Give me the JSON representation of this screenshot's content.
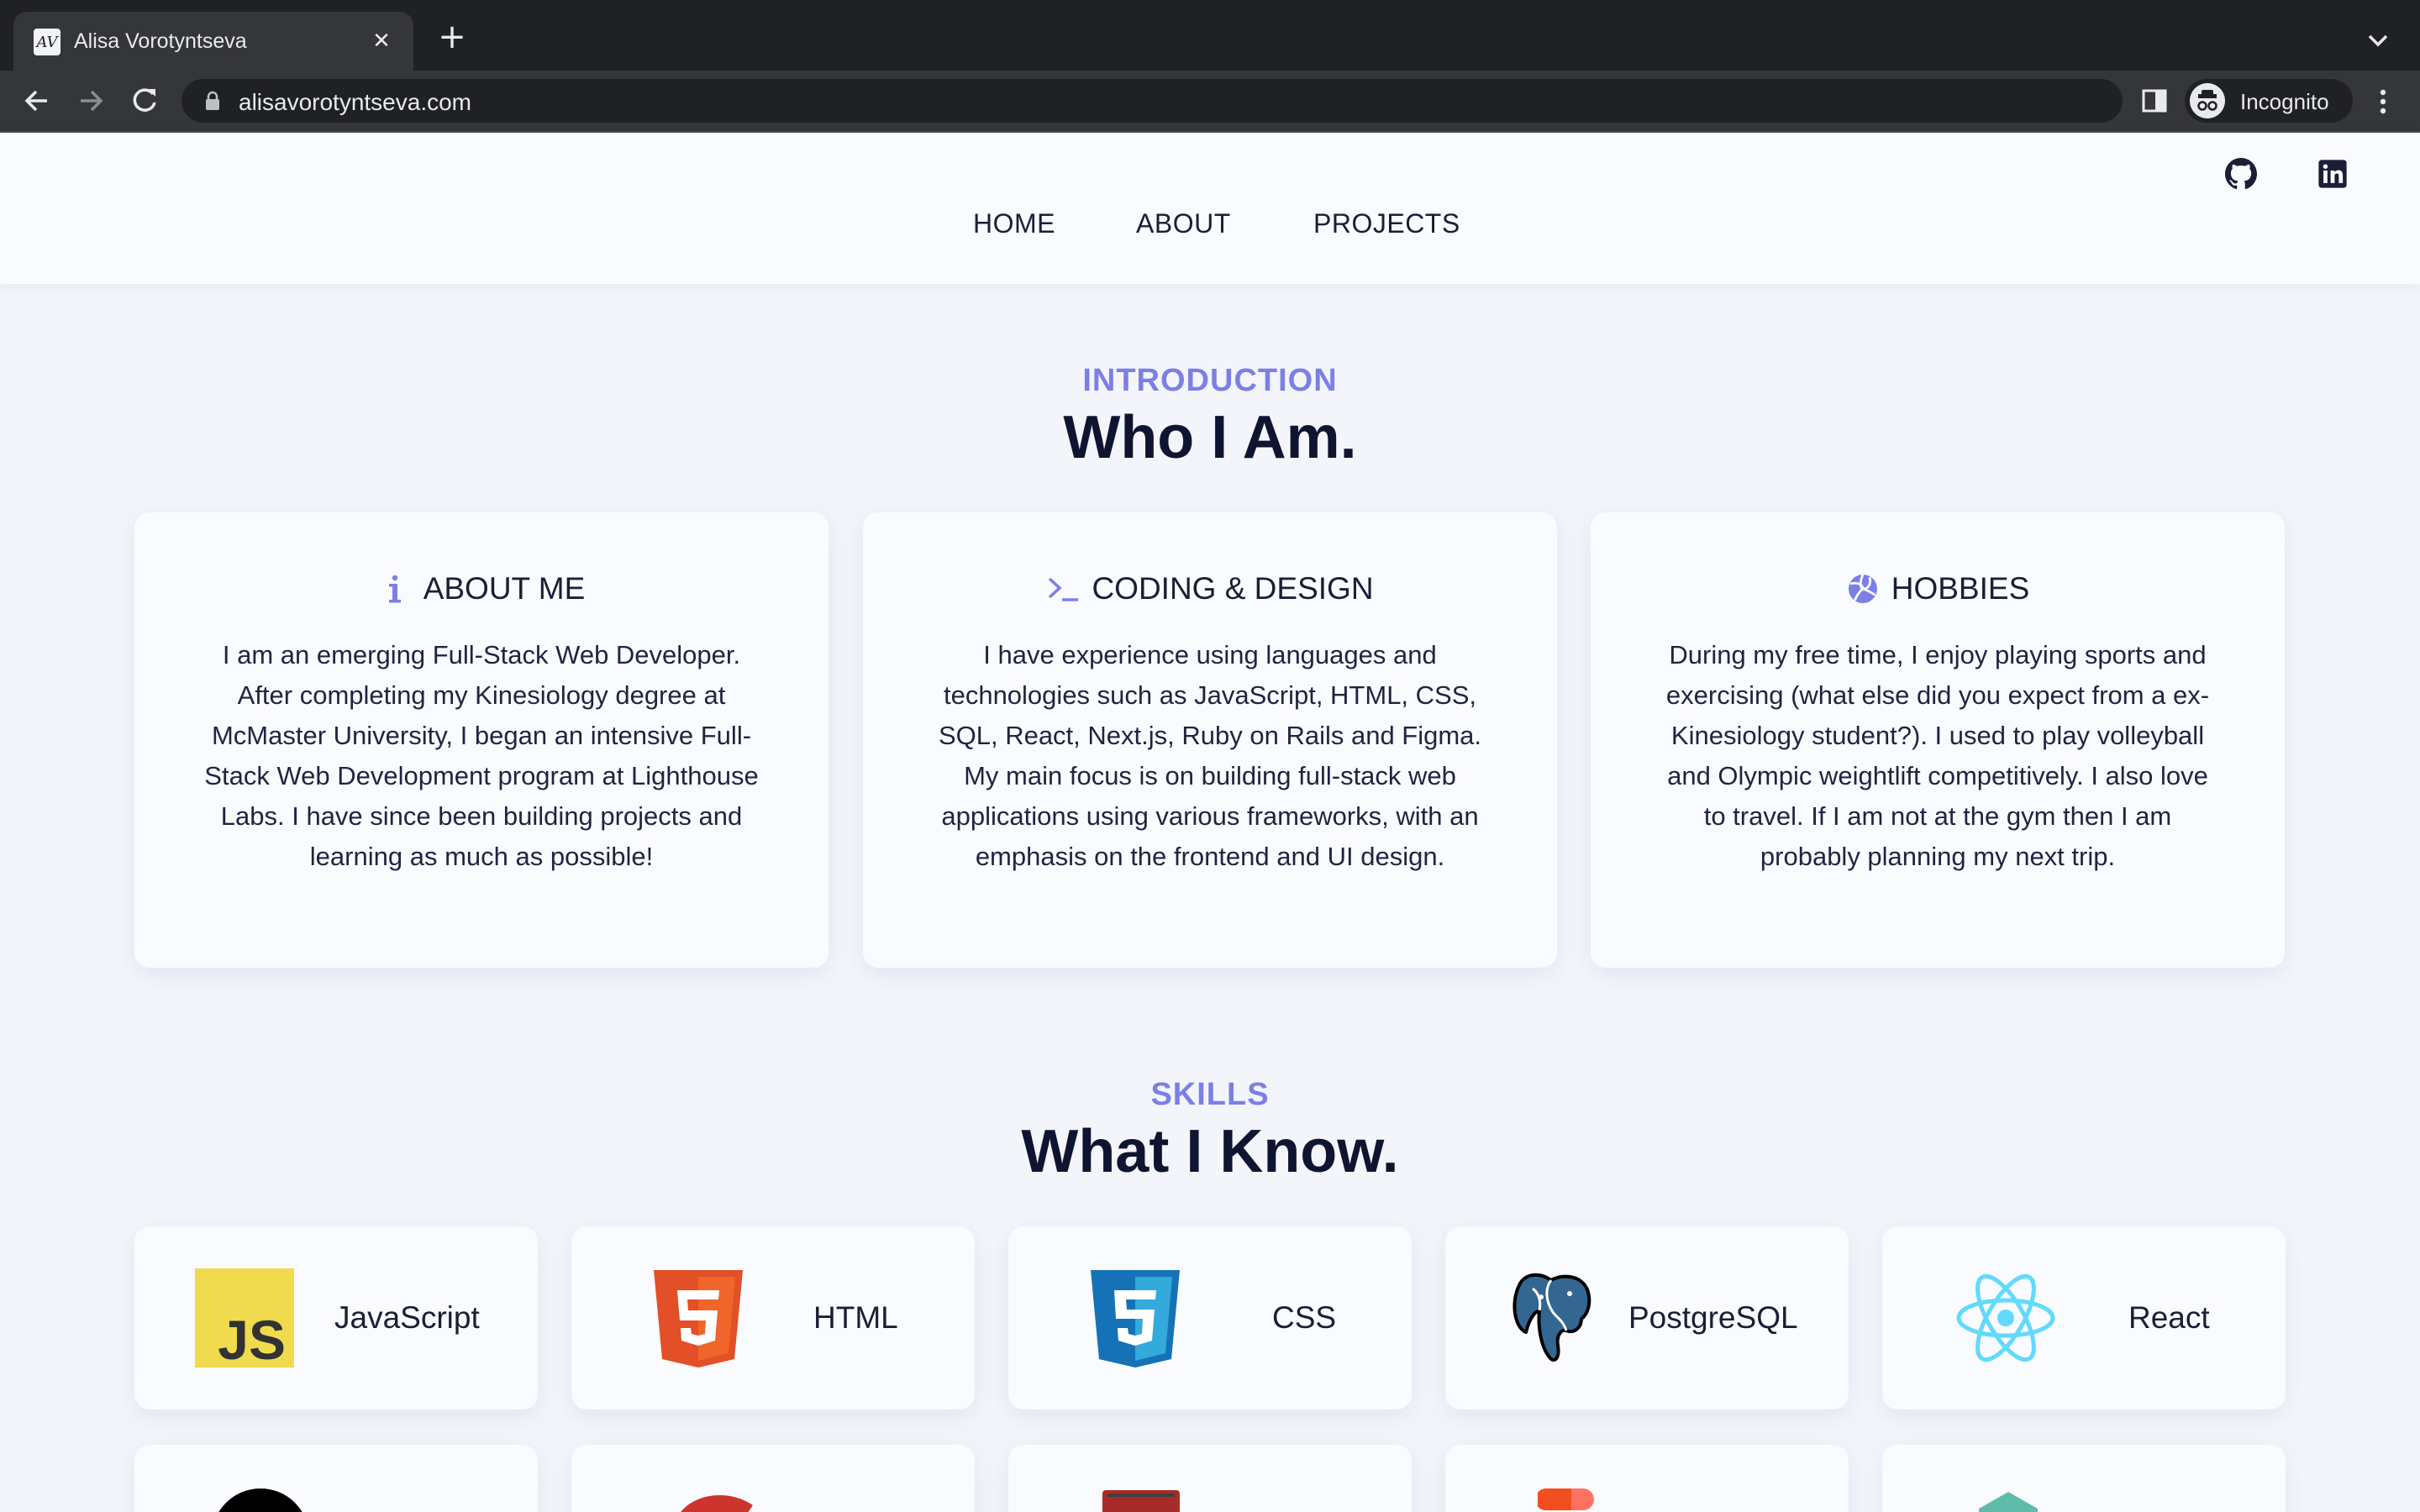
{
  "browser": {
    "tab_title": "Alisa Vorotyntseva",
    "url": "alisavorotyntseva.com",
    "incognito_label": "Incognito"
  },
  "nav": {
    "links": [
      "HOME",
      "ABOUT",
      "PROJECTS"
    ]
  },
  "intro": {
    "eyebrow": "INTRODUCTION",
    "heading": "Who I Am.",
    "cards": [
      {
        "icon": "info-icon",
        "title": "ABOUT ME",
        "text": "I am an emerging Full-Stack Web Developer. After completing my Kinesiology degree at McMaster University, I began an intensive Full-Stack Web Development program at Lighthouse Labs. I have since been building projects and learning as much as possible!"
      },
      {
        "icon": "terminal-icon",
        "title": "CODING & DESIGN",
        "text": "I have experience using languages and technologies such as JavaScript, HTML, CSS, SQL, React, Next.js, Ruby on Rails and Figma. My main focus is on building full-stack web applications using various frameworks, with an emphasis on the frontend and UI design."
      },
      {
        "icon": "volleyball-icon",
        "title": "HOBBIES",
        "text": "During my free time, I enjoy playing sports and exercising (what else did you expect from a ex-Kinesiology student?). I used to play volleyball and Olympic weightlift competitively. I also love to travel. If I am not at the gym then I am probably planning my next trip."
      }
    ]
  },
  "skills": {
    "eyebrow": "SKILLS",
    "heading": "What I Know.",
    "items": [
      {
        "label": "JavaScript",
        "icon": "javascript-logo"
      },
      {
        "label": "HTML",
        "icon": "html5-logo"
      },
      {
        "label": "CSS",
        "icon": "css3-logo"
      },
      {
        "label": "PostgreSQL",
        "icon": "postgresql-logo"
      },
      {
        "label": "React",
        "icon": "react-logo"
      }
    ],
    "row2_icons": [
      "nextjs-logo",
      "ruby-logo",
      "rails-logo",
      "figma-logo",
      "node-logo"
    ]
  },
  "colors": {
    "accent": "#7b7fe6",
    "heading": "#0f1530",
    "page_bg": "#f3f5fb",
    "card_bg": "#fafbff"
  }
}
